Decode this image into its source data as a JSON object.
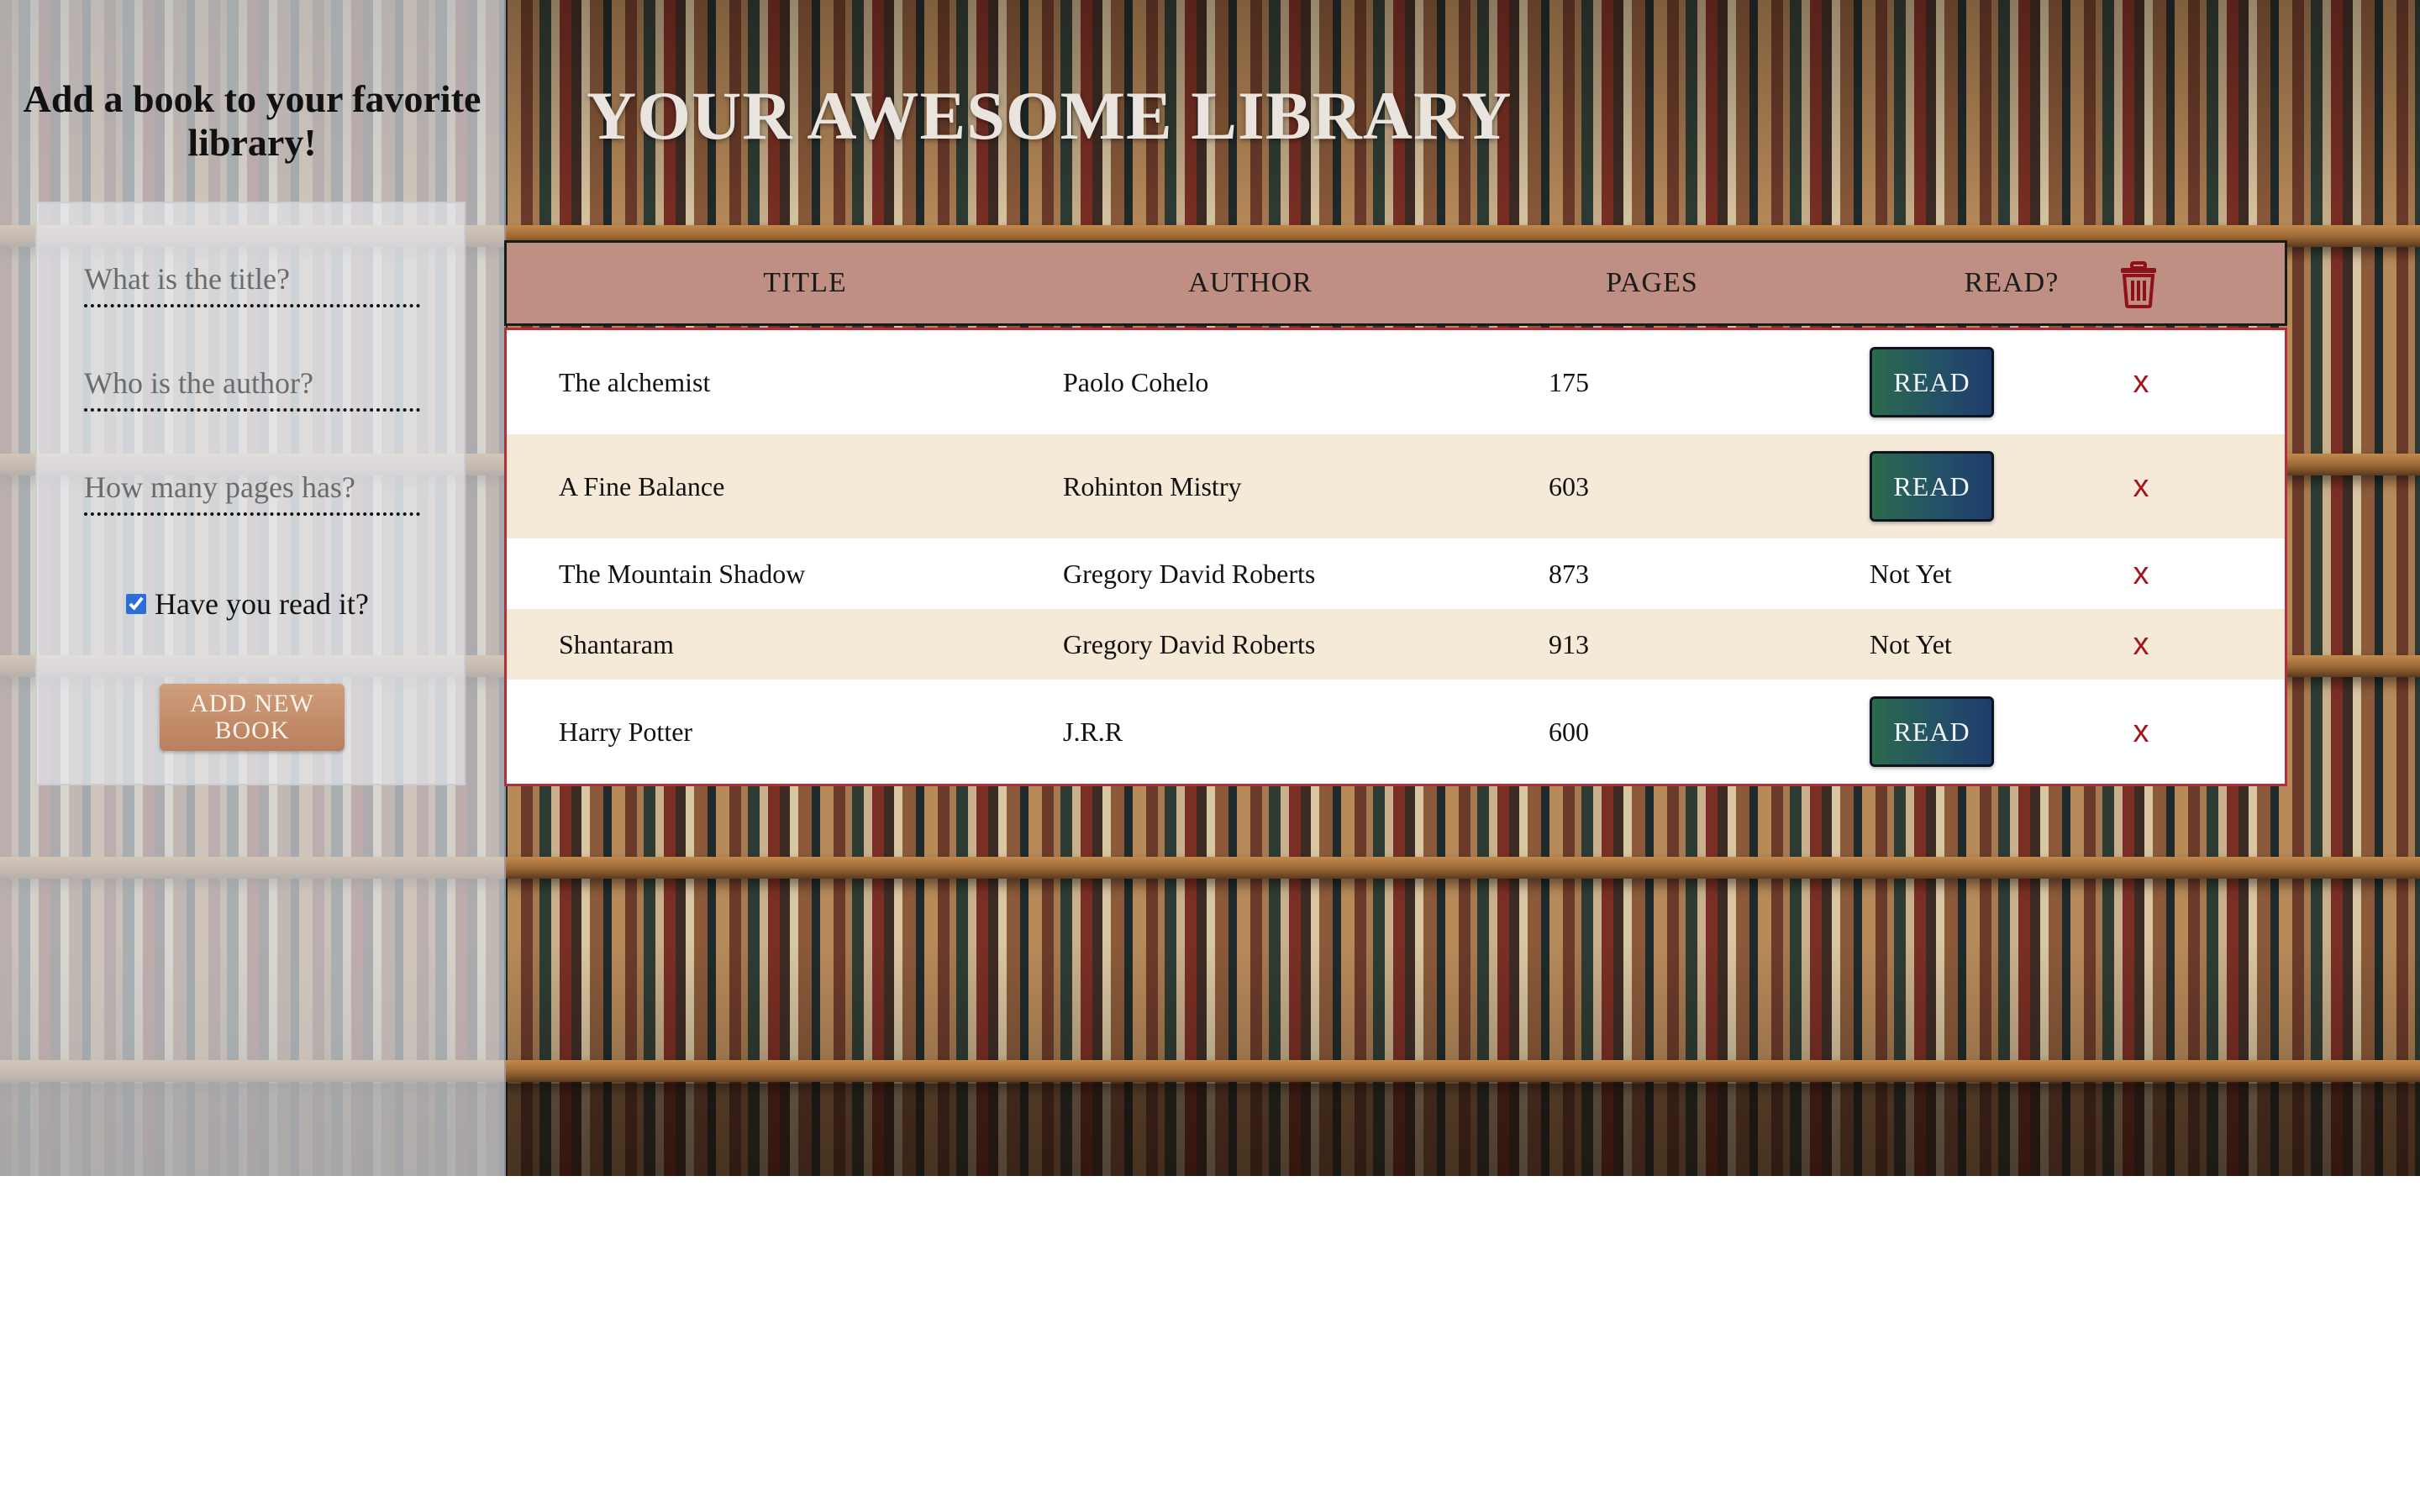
{
  "sidebar": {
    "title": "Add a book to your favorite library!",
    "form": {
      "title_placeholder": "What is the title?",
      "author_placeholder": "Who is the author?",
      "pages_placeholder": "How many pages has?",
      "read_checked": true,
      "read_label": "Have you read it?",
      "submit_label": "ADD NEW BOOK"
    }
  },
  "main": {
    "title": "YOUR AWESOME LIBRARY"
  },
  "table": {
    "headers": {
      "title": "TITLE",
      "author": "AUTHOR",
      "pages": "PAGES",
      "read": "READ?"
    },
    "delete_all_icon": "trash-icon",
    "delete_row_label": "x",
    "rows": [
      {
        "title": "The alchemist",
        "author": "Paolo Cohelo",
        "pages": "175",
        "read": "READ",
        "is_read": true
      },
      {
        "title": "A Fine Balance",
        "author": "Rohinton Mistry",
        "pages": "603",
        "read": "READ",
        "is_read": true
      },
      {
        "title": "The Mountain Shadow",
        "author": "Gregory David Roberts",
        "pages": "873",
        "read": "Not Yet",
        "is_read": false
      },
      {
        "title": "Shantaram",
        "author": "Gregory David Roberts",
        "pages": "913",
        "read": "Not Yet",
        "is_read": false
      },
      {
        "title": "Harry Potter",
        "author": "J.R.R",
        "pages": "600",
        "read": "READ",
        "is_read": true
      }
    ]
  },
  "colors": {
    "header_bg": "#bf8f84",
    "table_border": "#b3303a",
    "delete_x": "#a5161e",
    "add_button": "#c49070",
    "read_button_start": "#2b6a4c",
    "read_button_end": "#1f3c6a"
  }
}
